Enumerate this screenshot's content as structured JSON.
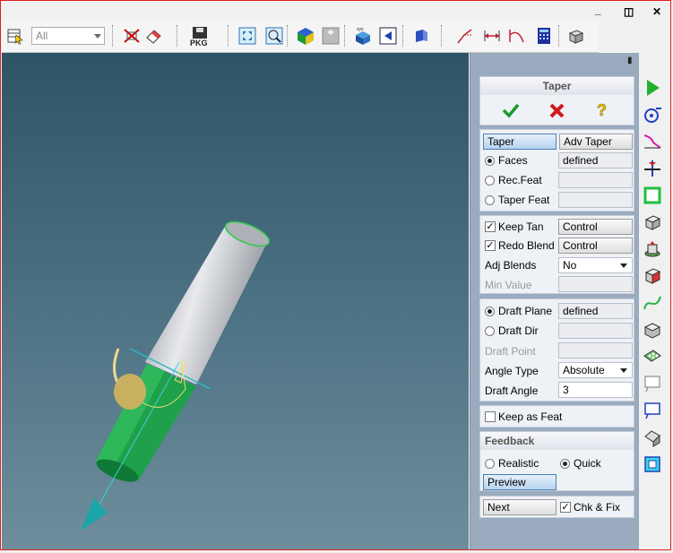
{
  "toolbar": {
    "filter_value": "All",
    "pkg_label": "PKG"
  },
  "taper_panel": {
    "title": "Taper",
    "tabs": [
      "Taper",
      "Adv Taper"
    ],
    "faces_label": "Faces",
    "faces_value": "defined",
    "rec_feat_label": "Rec.Feat",
    "taper_feat_label": "Taper Feat"
  },
  "blend_section": {
    "keep_tan_label": "Keep Tan",
    "keep_tan_btn": "Control",
    "redo_blend_label": "Redo Blend",
    "redo_blend_btn": "Control",
    "adj_blends_label": "Adj Blends",
    "adj_blends_value": "No",
    "min_value_label": "Min Value"
  },
  "draft_section": {
    "draft_plane_label": "Draft Plane",
    "draft_plane_value": "defined",
    "draft_dir_label": "Draft Dir",
    "draft_point_label": "Draft Point",
    "angle_type_label": "Angle Type",
    "angle_type_value": "Absolute",
    "draft_angle_label": "Draft Angle",
    "draft_angle_value": "3"
  },
  "keep_feat_label": "Keep as Feat",
  "feedback": {
    "title": "Feedback",
    "realistic_label": "Realistic",
    "quick_label": "Quick",
    "preview_label": "Preview"
  },
  "footer": {
    "next_label": "Next",
    "chk_fix_label": "Chk & Fix"
  },
  "colors": {
    "accent": "#4a7fb7",
    "model_green": "#1fa04a",
    "viewport_top": "#2e5466"
  }
}
